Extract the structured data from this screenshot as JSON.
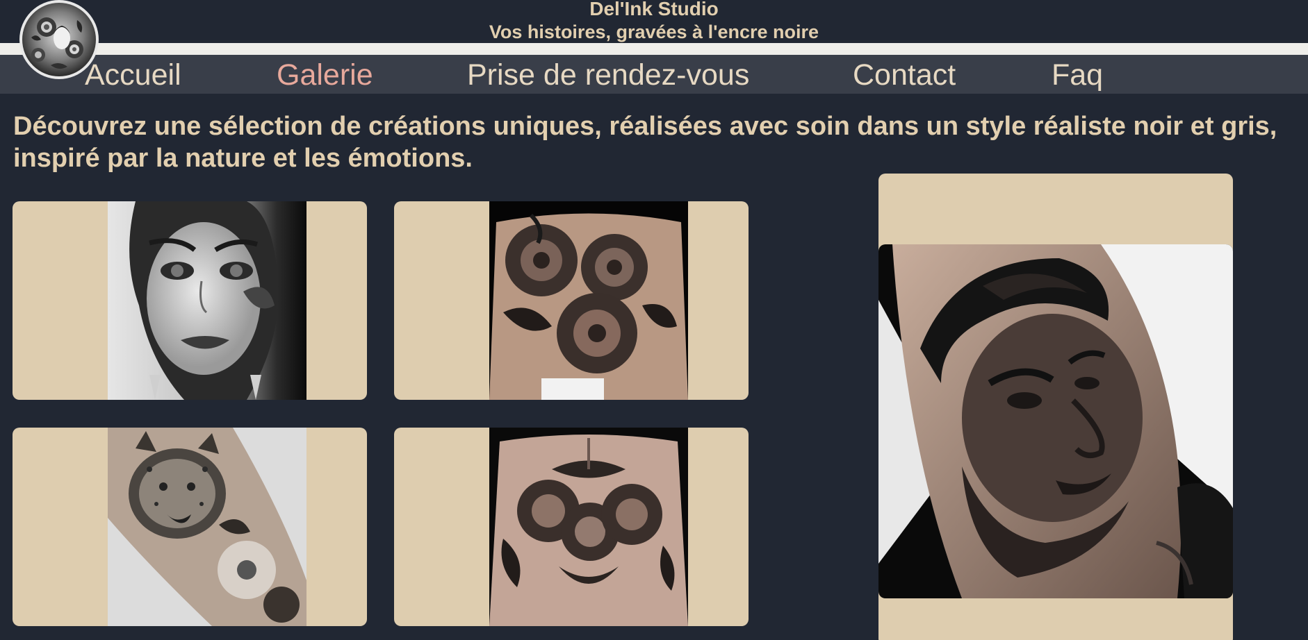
{
  "header": {
    "title": "Del'Ink Studio",
    "tagline": "Vos histoires, gravées à l'encre noire"
  },
  "nav": {
    "items": [
      {
        "label": "Accueil",
        "active": false
      },
      {
        "label": "Galerie",
        "active": true
      },
      {
        "label": "Prise de rendez-vous",
        "active": false
      },
      {
        "label": "Contact",
        "active": false
      },
      {
        "label": "Faq",
        "active": false
      }
    ]
  },
  "gallery": {
    "intro": "Découvrez une sélection de créations uniques, réalisées avec soin dans un style réaliste noir et gris, inspiré par la nature et les émotions.",
    "images": [
      {
        "subject": "woman-portrait-tattoo"
      },
      {
        "subject": "flower-back-tattoo"
      },
      {
        "subject": "leopard-flower-arm-tattoo"
      },
      {
        "subject": "rose-back-tattoo"
      },
      {
        "subject": "man-portrait-forearm-tattoo"
      }
    ]
  },
  "colors": {
    "background": "#212733",
    "nav_bar": "#393e49",
    "stripe": "#efeeea",
    "text_beige": "#e2cfaf",
    "nav_active": "#e8a99c",
    "card": "#decdaf"
  }
}
